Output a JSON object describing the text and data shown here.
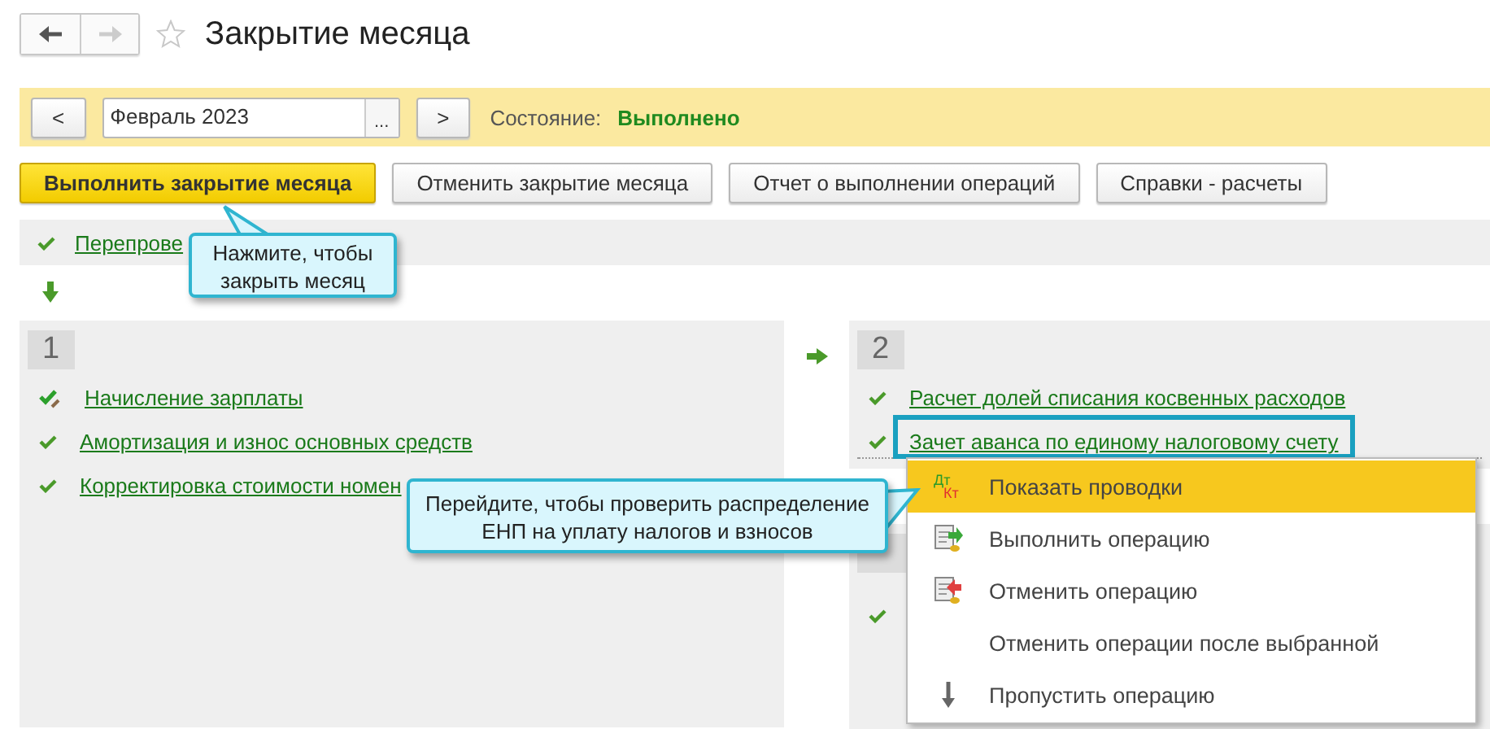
{
  "window": {
    "title": "Закрытие месяца",
    "favorite": false
  },
  "period": {
    "prev": "<",
    "value": "Февраль 2023",
    "choose": "...",
    "next": ">",
    "state_label": "Состояние:",
    "state_value": "Выполнено"
  },
  "actions": [
    {
      "label": "Выполнить закрытие месяца",
      "primary": true
    },
    {
      "label": "Отменить закрытие месяца",
      "primary": false
    },
    {
      "label": "Отчет о выполнении операций",
      "primary": false
    },
    {
      "label": "Справки - расчеты",
      "primary": false
    }
  ],
  "pre_step": {
    "label": "Перепрове",
    "kind": "done"
  },
  "groups": [
    {
      "number": "1",
      "operations": [
        {
          "label": "Начисление зарплаты",
          "kind": "edited"
        },
        {
          "label": "Амортизация и износ основных средств",
          "kind": "done"
        },
        {
          "label": "Корректировка стоимости номен",
          "kind": "done"
        }
      ]
    },
    {
      "number": "2",
      "operations": [
        {
          "label": "Расчет долей списания косвенных расходов",
          "kind": "done"
        },
        {
          "label": "Зачет аванса по единому налоговому счету",
          "kind": "done"
        }
      ]
    },
    {
      "operations": [
        {
          "kind": "done"
        }
      ]
    }
  ],
  "hints": [
    {
      "text": "Нажмите, чтобы закрыть месяц"
    },
    {
      "text": "Перейдите, чтобы проверить распределение ЕНП на уплату налогов и взносов"
    }
  ],
  "context_menu": [
    {
      "label": "Показать проводки",
      "kind": "entries",
      "debit_mark": "Дт",
      "credit_mark": "Кт",
      "selected": true
    },
    {
      "label": "Выполнить операцию",
      "kind": "run",
      "selected": false
    },
    {
      "label": "Отменить операцию",
      "kind": "undo",
      "selected": false
    },
    {
      "label": "Отменить операции после выбранной",
      "kind": "plain",
      "selected": false
    },
    {
      "label": "Пропустить операцию",
      "kind": "skip",
      "selected": false
    }
  ]
}
